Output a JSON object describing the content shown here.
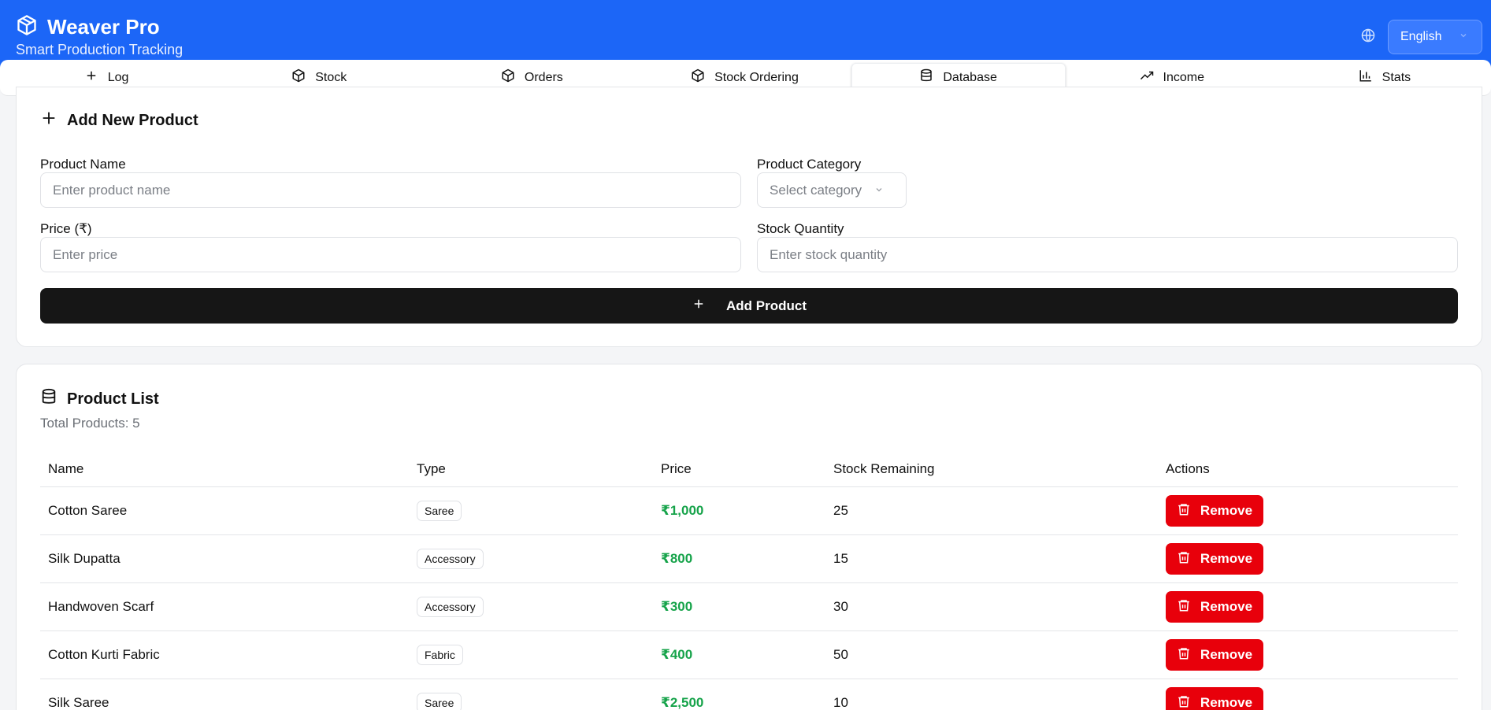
{
  "header": {
    "title": "Weaver Pro",
    "subtitle": "Smart Production Tracking",
    "language": "English",
    "logo_icon": "box-icon",
    "language_icon": "globe-icon"
  },
  "tabs": [
    {
      "label": "Log",
      "icon": "plus-icon",
      "active": false
    },
    {
      "label": "Stock",
      "icon": "box-icon",
      "active": false
    },
    {
      "label": "Orders",
      "icon": "box-icon",
      "active": false
    },
    {
      "label": "Stock Ordering",
      "icon": "box-icon",
      "active": false
    },
    {
      "label": "Database",
      "icon": "database-icon",
      "active": true
    },
    {
      "label": "Income",
      "icon": "trending-up-icon",
      "active": false
    },
    {
      "label": "Stats",
      "icon": "bar-chart-icon",
      "active": false
    }
  ],
  "add_product": {
    "title": "Add New Product",
    "name_label": "Product Name",
    "name_placeholder": "Enter product name",
    "category_label": "Product Category",
    "category_placeholder": "Select category",
    "price_label": "Price (₹)",
    "price_placeholder": "Enter price",
    "stock_label": "Stock Quantity",
    "stock_placeholder": "Enter stock quantity",
    "button_label": "Add Product"
  },
  "product_list": {
    "title": "Product List",
    "total_text": "Total Products: 5",
    "columns": [
      "Name",
      "Type",
      "Price",
      "Stock Remaining",
      "Actions"
    ],
    "remove_label": "Remove",
    "rows": [
      {
        "name": "Cotton Saree",
        "type": "Saree",
        "price": "₹1,000",
        "stock": "25"
      },
      {
        "name": "Silk Dupatta",
        "type": "Accessory",
        "price": "₹800",
        "stock": "15"
      },
      {
        "name": "Handwoven Scarf",
        "type": "Accessory",
        "price": "₹300",
        "stock": "30"
      },
      {
        "name": "Cotton Kurti Fabric",
        "type": "Fabric",
        "price": "₹400",
        "stock": "50"
      },
      {
        "name": "Silk Saree",
        "type": "Saree",
        "price": "₹2,500",
        "stock": "10"
      }
    ]
  },
  "colors": {
    "header_bg": "#1c66f7",
    "price_green": "#16a34a",
    "remove_red": "#e8000b",
    "primary_button": "#161616"
  }
}
